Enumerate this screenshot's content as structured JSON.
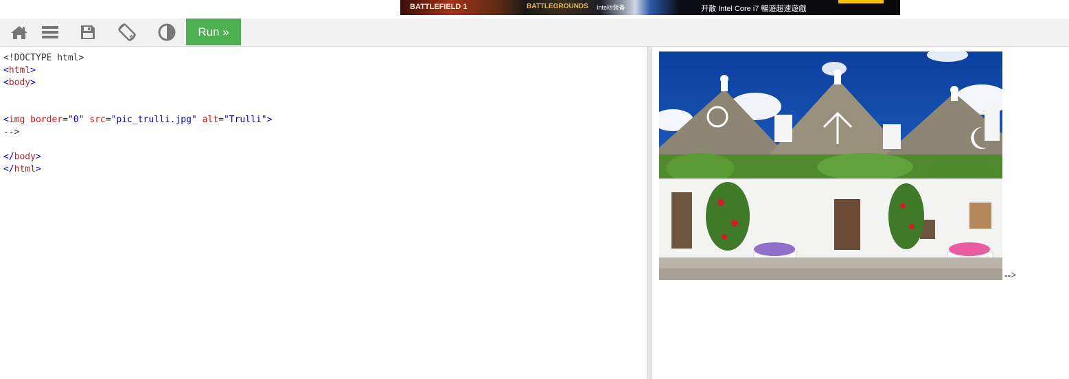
{
  "ad": {
    "text1": "BATTLEFIELD 1",
    "text2": "BATTLEGROUNDS",
    "text3": "Intel®装备",
    "text4": "开散 Intel Core i7 暢遊超速遊戲",
    "bg_color": "#0a0a0a",
    "cta_color": "#f5c400"
  },
  "toolbar": {
    "icons": [
      "home-icon",
      "menu-icon",
      "save-icon",
      "rotate-icon",
      "contrast-icon"
    ],
    "run_label": "Run »",
    "run_color": "#4caf50"
  },
  "code": {
    "lines": [
      "<!DOCTYPE html>",
      "<html>",
      "<body>",
      "",
      "",
      "<img border=\"0\" src=\"pic_trulli.jpg\" alt=\"Trulli\">",
      "-->",
      "",
      "</body>",
      "</html>"
    ],
    "doctype": "<!DOCTYPE html>",
    "html_open_lt": "<",
    "html_open_name": "html",
    "html_open_gt": ">",
    "body_open_name": "body",
    "img_name": "img",
    "img_attr_border": "border",
    "img_val_border": "\"0\"",
    "img_attr_src": "src",
    "img_val_src": "\"pic_trulli.jpg\"",
    "img_attr_alt": "alt",
    "img_val_alt": "\"Trulli\"",
    "comment_close": "-->",
    "body_close_name": "body",
    "html_close_name": "html"
  },
  "result": {
    "image_alt": "Trulli",
    "trailing_text": "-->"
  }
}
